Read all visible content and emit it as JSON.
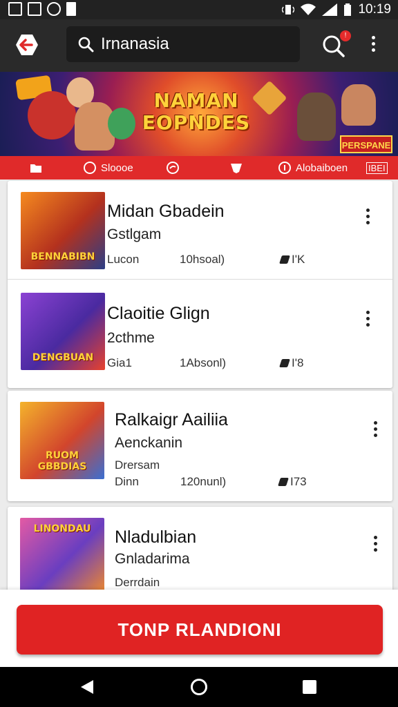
{
  "status_bar": {
    "time": "10:19"
  },
  "app_bar": {
    "search_value": "Irnanasia",
    "notification_count": "!"
  },
  "banner": {
    "title_line1": "NAMAN",
    "title_line2": "EOPNDES",
    "corner_text": "PERSPANE"
  },
  "categories": [
    {
      "label": "",
      "icon": "folder-icon"
    },
    {
      "label": "Sloooe",
      "icon": "face-icon"
    },
    {
      "label": "",
      "icon": "chat-icon"
    },
    {
      "label": "",
      "icon": "shield-icon"
    },
    {
      "label": "Alobaiboen",
      "icon": "info-icon"
    },
    {
      "label": "IBEI",
      "icon": ""
    }
  ],
  "games": [
    {
      "title": "Midan Gbadein",
      "subtitle": "Gstlgam",
      "meta": "Lucon",
      "date": "10hsoal)",
      "size": "I'K",
      "thumb_label": "BENNABIBN",
      "thumb_colors": [
        "#f58a1f",
        "#b4311e",
        "#2b3e86"
      ]
    },
    {
      "title": "Claoitie Glign",
      "subtitle": "2cthme",
      "meta": "Gia1",
      "date": "1Absonl)",
      "size": "I'8",
      "thumb_label": "DENGBUAN",
      "thumb_colors": [
        "#8b42d3",
        "#4a2aa0",
        "#e8422c"
      ]
    },
    {
      "title": "Ralkaigr Aailiia",
      "subtitle": "Aenckanin",
      "meta": "Drersam",
      "meta2": "Dinn",
      "date": "120nunl)",
      "size": "I73",
      "thumb_label": "RUOM GBBDIAS",
      "thumb_colors": [
        "#f4b32c",
        "#d2452c",
        "#3a6fd2"
      ]
    },
    {
      "title": "Nladulbian",
      "subtitle": "Gnladarima",
      "meta": "Derrdain",
      "date": "",
      "size": "",
      "thumb_label": "LINONDAU",
      "thumb_colors": [
        "#e35aa4",
        "#6a3ec0",
        "#f08a2a"
      ]
    }
  ],
  "cta": {
    "label": "TONP RLANDIONI"
  },
  "colors": {
    "accent": "#e02a2a",
    "appbar": "#2a2a2a"
  }
}
